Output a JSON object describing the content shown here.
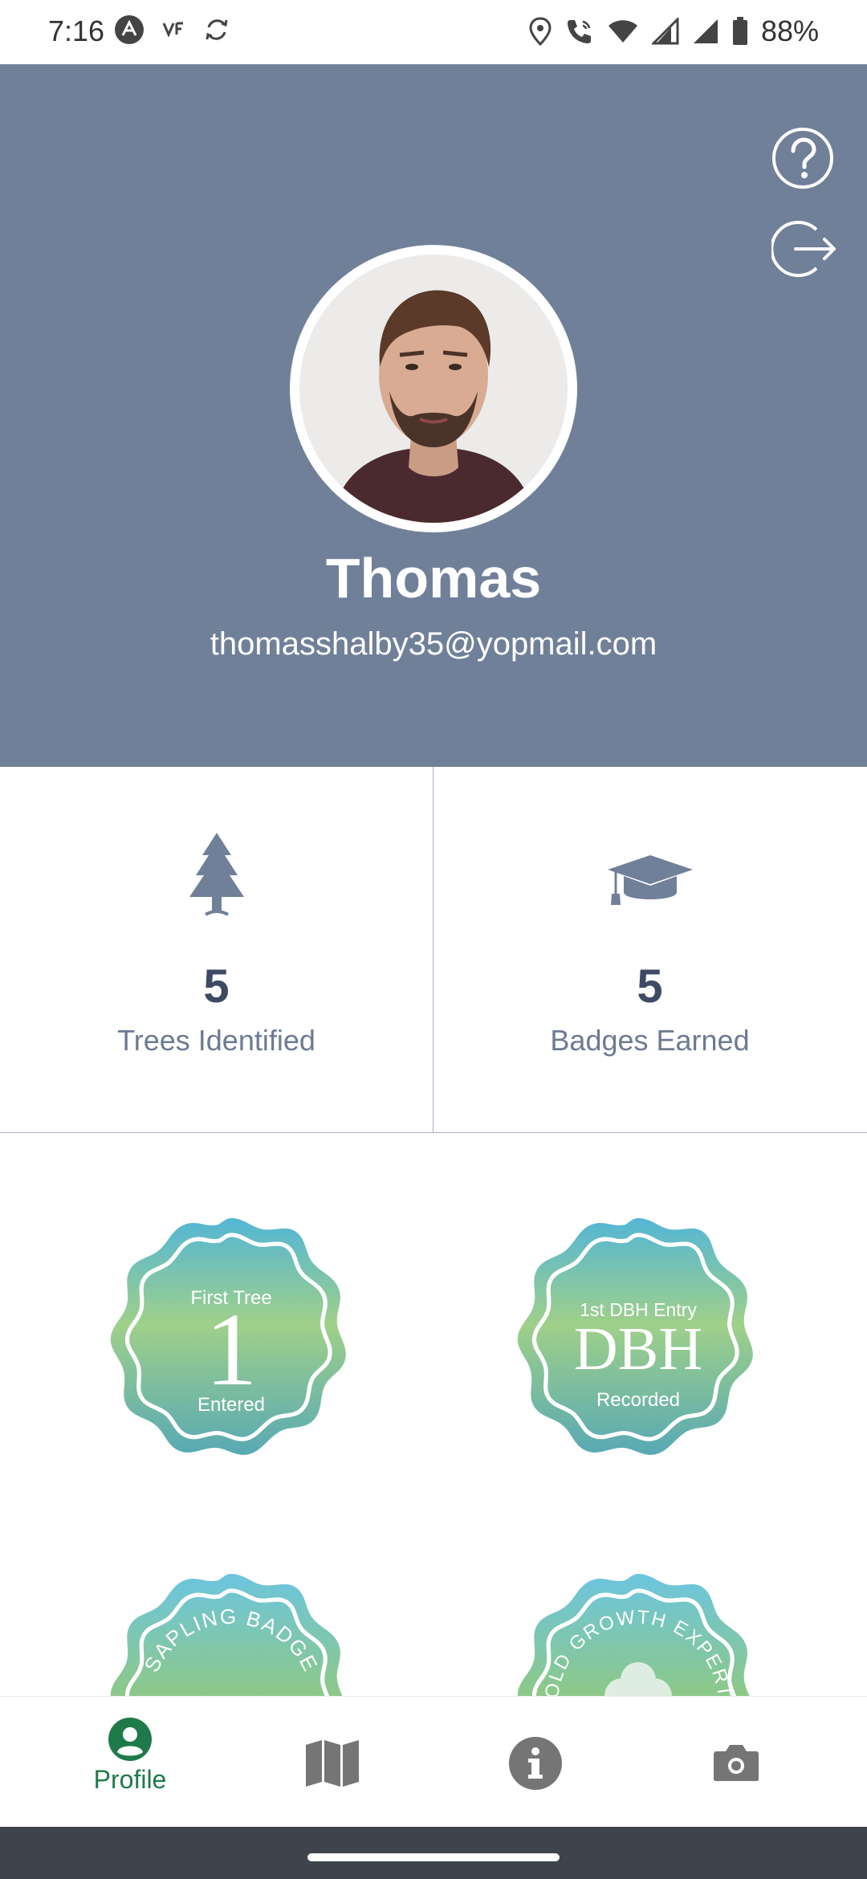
{
  "status_bar": {
    "time": "7:16",
    "battery": "88%"
  },
  "profile": {
    "name": "Thomas",
    "email": "thomasshalby35@yopmail.com"
  },
  "stats": [
    {
      "value": "5",
      "label": "Trees Identified",
      "icon": "tree-icon"
    },
    {
      "value": "5",
      "label": "Badges Earned",
      "icon": "graduation-cap-icon"
    }
  ],
  "badges": [
    {
      "top": "First Tree",
      "main": "1",
      "bottom": "Entered"
    },
    {
      "top": "1st DBH Entry",
      "main": "DBH",
      "bottom": "Recorded"
    },
    {
      "arc": "SAPLING BADGE"
    },
    {
      "arc": "OLD GROWTH EXPERT"
    }
  ],
  "nav": {
    "profile_label": "Profile"
  },
  "colors": {
    "header": "#718099",
    "accent_green": "#1f7a4a",
    "stat_text": "#3d4a63"
  }
}
